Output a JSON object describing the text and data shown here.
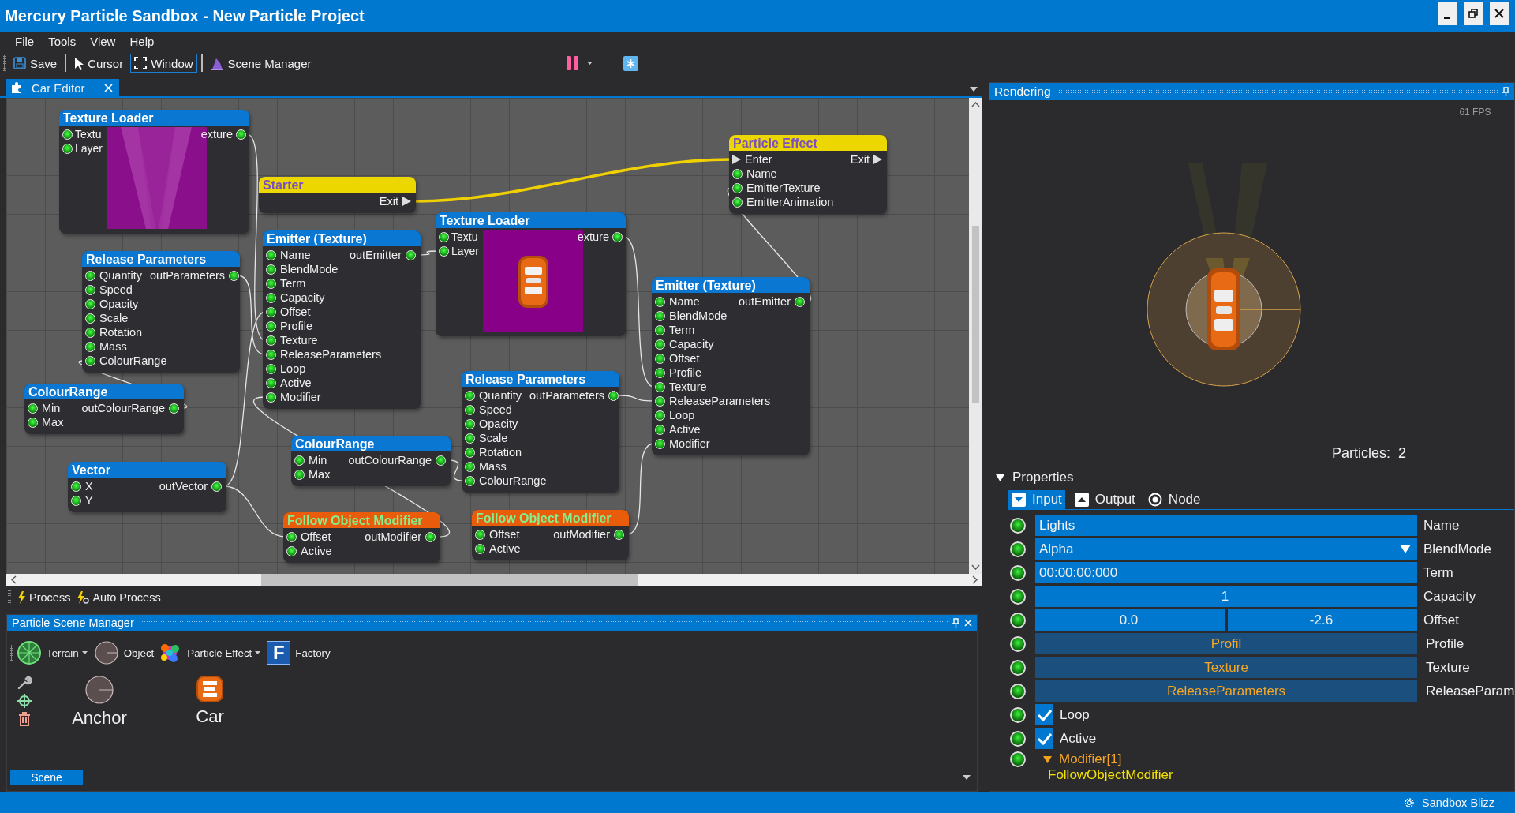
{
  "window": {
    "title": "Mercury Particle Sandbox - New Particle Project"
  },
  "menu": [
    "File",
    "Tools",
    "View",
    "Help"
  ],
  "toolbar": [
    {
      "label": "Save",
      "selected": false
    },
    {
      "label": "Cursor",
      "selected": false
    },
    {
      "label": "Window",
      "selected": true
    },
    {
      "label": "Scene Manager",
      "selected": false
    }
  ],
  "editor_tab": {
    "label": "Car Editor",
    "selected": true
  },
  "nodes": [
    {
      "title": "Texture Loader",
      "kind": "blue",
      "preview": {
        "kind": "light-beams"
      },
      "rows": [
        {
          "in": "Textu",
          "out": "exture"
        },
        {
          "in": "Layer"
        }
      ]
    },
    {
      "title": "Starter",
      "kind": "yellow",
      "rows": [
        {
          "out": "Exit",
          "kind": "flow"
        }
      ]
    },
    {
      "title": "Texture Loader",
      "kind": "blue",
      "preview": {
        "kind": "car"
      },
      "rows": [
        {
          "in": "Textu",
          "out": "exture"
        },
        {
          "in": "Layer"
        }
      ]
    },
    {
      "title": "Particle Effect",
      "kind": "yellow",
      "rows": [
        {
          "in": "Enter",
          "out": "Exit",
          "kind": "flow"
        },
        {
          "in": "Name",
          "kind": "data"
        },
        {
          "in": "EmitterTexture",
          "kind": "data"
        },
        {
          "in": "EmitterAnimation",
          "kind": "data"
        }
      ]
    },
    {
      "title": "Release Parameters",
      "kind": "blue",
      "rows": [
        {
          "in": "Quantity",
          "out": "outParameters"
        },
        {
          "in": "Speed"
        },
        {
          "in": "Opacity"
        },
        {
          "in": "Scale"
        },
        {
          "in": "Rotation"
        },
        {
          "in": "Mass"
        },
        {
          "in": "ColourRange"
        }
      ]
    },
    {
      "title": "Emitter (Texture)",
      "kind": "blue",
      "rows": [
        {
          "in": "Name",
          "out": "outEmitter"
        },
        {
          "in": "BlendMode"
        },
        {
          "in": "Term"
        },
        {
          "in": "Capacity"
        },
        {
          "in": "Offset"
        },
        {
          "in": "Profile"
        },
        {
          "in": "Texture"
        },
        {
          "in": "ReleaseParameters"
        },
        {
          "in": "Loop"
        },
        {
          "in": "Active"
        },
        {
          "in": "Modifier"
        }
      ]
    },
    {
      "title": "ColourRange",
      "kind": "blue",
      "rows": [
        {
          "in": "Min",
          "out": "outColourRange"
        },
        {
          "in": "Max"
        }
      ]
    },
    {
      "title": "Emitter (Texture)",
      "kind": "blue",
      "rows": [
        {
          "in": "Name",
          "out": "outEmitter"
        },
        {
          "in": "BlendMode"
        },
        {
          "in": "Term"
        },
        {
          "in": "Capacity"
        },
        {
          "in": "Offset"
        },
        {
          "in": "Profile"
        },
        {
          "in": "Texture"
        },
        {
          "in": "ReleaseParameters"
        },
        {
          "in": "Loop"
        },
        {
          "in": "Active"
        },
        {
          "in": "Modifier"
        }
      ]
    },
    {
      "title": "Release Parameters",
      "kind": "blue",
      "rows": [
        {
          "in": "Quantity",
          "out": "outParameters"
        },
        {
          "in": "Speed"
        },
        {
          "in": "Opacity"
        },
        {
          "in": "Scale"
        },
        {
          "in": "Rotation"
        },
        {
          "in": "Mass"
        },
        {
          "in": "ColourRange"
        }
      ]
    },
    {
      "title": "ColourRange",
      "kind": "blue",
      "rows": [
        {
          "in": "Min",
          "out": "outColourRange"
        },
        {
          "in": "Max"
        }
      ]
    },
    {
      "title": "Vector",
      "kind": "blue",
      "rows": [
        {
          "in": "X",
          "out": "outVector"
        },
        {
          "in": "Y"
        }
      ]
    },
    {
      "title": "Follow Object Modifier",
      "kind": "orange",
      "rows": [
        {
          "in": "Offset",
          "out": "outModifier"
        },
        {
          "in": "Active"
        }
      ]
    },
    {
      "title": "Follow Object Modifier",
      "kind": "orange",
      "rows": [
        {
          "in": "Offset",
          "out": "outModifier"
        },
        {
          "in": "Active"
        }
      ]
    }
  ],
  "process_bar": [
    "Process",
    "Auto Process"
  ],
  "scene_manager": {
    "title": "Particle Scene Manager",
    "tools": [
      {
        "label": "Terrain",
        "dropdown": true
      },
      {
        "label": "Object",
        "dropdown": false
      },
      {
        "label": "Particle Effect",
        "dropdown": true
      },
      {
        "label": "Factory",
        "dropdown": false,
        "icon_text": "F"
      }
    ],
    "objects": [
      {
        "label": "Anchor"
      },
      {
        "label": "Car"
      }
    ],
    "tabs": [
      {
        "label": "Scene",
        "selected": true
      }
    ]
  },
  "rendering": {
    "title": "Rendering",
    "fps": "61 FPS",
    "particles_label": "Particles:",
    "particles": "2"
  },
  "properties": {
    "title": "Properties",
    "expanded": true,
    "tabs": [
      {
        "label": "Input",
        "selected": true
      },
      {
        "label": "Output",
        "selected": false
      },
      {
        "label": "Node",
        "selected": false
      }
    ],
    "rows": [
      {
        "kind": "text",
        "value": "Lights",
        "label": "Name"
      },
      {
        "kind": "dropdown",
        "value": "Alpha",
        "label": "BlendMode"
      },
      {
        "kind": "text",
        "value": "00:00:00:000",
        "label": "Term"
      },
      {
        "kind": "number",
        "value": "1",
        "label": "Capacity"
      },
      {
        "kind": "vector",
        "values": [
          "0.0",
          "-2.6"
        ],
        "label": "Offset"
      },
      {
        "kind": "link",
        "value": "Profil",
        "label": "Profile"
      },
      {
        "kind": "link",
        "value": "Texture",
        "label": "Texture"
      },
      {
        "kind": "link",
        "value": "ReleaseParameters",
        "label": "ReleaseParam"
      },
      {
        "kind": "check",
        "label": "Loop",
        "checked": true
      },
      {
        "kind": "check",
        "label": "Active",
        "checked": true
      },
      {
        "kind": "list",
        "label": "Modifier[1]",
        "expanded": true,
        "items": [
          "FollowObjectModifier"
        ]
      }
    ]
  },
  "status_bar": {
    "text": "Sandbox Blizz"
  }
}
